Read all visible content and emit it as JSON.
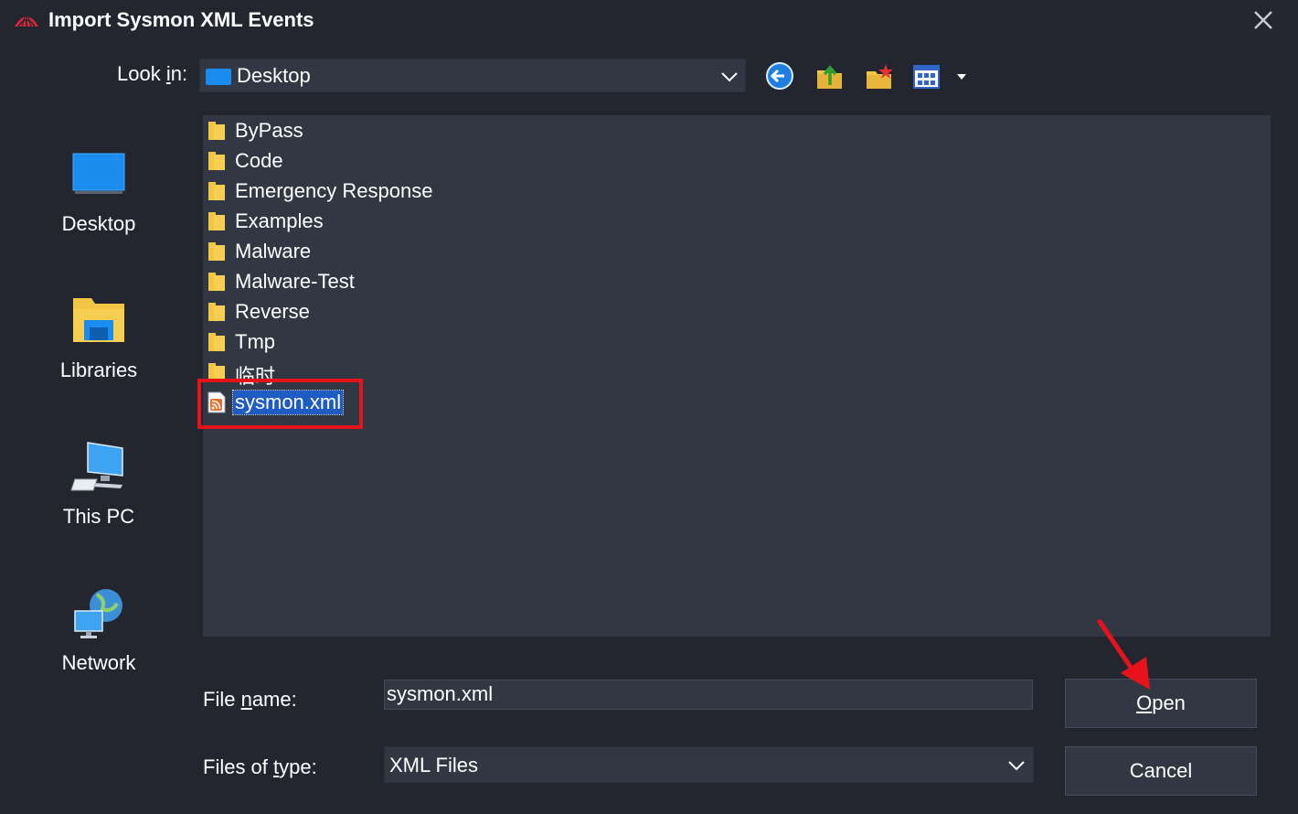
{
  "window": {
    "title": "Import Sysmon XML Events"
  },
  "lookin": {
    "label_pre": "Look ",
    "label_u": "i",
    "label_post": "n:",
    "value": "Desktop"
  },
  "toolbar": {
    "icons": [
      "back-icon",
      "up-folder-icon",
      "new-folder-icon",
      "view-menu-icon"
    ]
  },
  "places": [
    {
      "label": "Desktop",
      "icon": "desktop-icon"
    },
    {
      "label": "Libraries",
      "icon": "libraries-icon"
    },
    {
      "label": "This PC",
      "icon": "this-pc-icon"
    },
    {
      "label": "Network",
      "icon": "network-icon"
    }
  ],
  "files": [
    {
      "name": "ByPass",
      "type": "folder"
    },
    {
      "name": "Code",
      "type": "folder"
    },
    {
      "name": "Emergency Response",
      "type": "folder"
    },
    {
      "name": "Examples",
      "type": "folder"
    },
    {
      "name": "Malware",
      "type": "folder"
    },
    {
      "name": "Malware-Test",
      "type": "folder"
    },
    {
      "name": "Reverse",
      "type": "folder"
    },
    {
      "name": "Tmp",
      "type": "folder"
    },
    {
      "name": "临时",
      "type": "folder"
    },
    {
      "name": "sysmon.xml",
      "type": "xml",
      "selected": true
    }
  ],
  "filename": {
    "label_pre": "File ",
    "label_u": "n",
    "label_post": "ame:",
    "value": "sysmon.xml"
  },
  "filetype": {
    "label_pre": "Files of ",
    "label_u": "t",
    "label_post": "ype:",
    "value": "XML Files"
  },
  "buttons": {
    "open_u": "O",
    "open_rest": "pen",
    "cancel": "Cancel"
  },
  "colors": {
    "background": "#23262f",
    "panel": "#323744",
    "selection": "#1e5cc4",
    "highlight": "#e8131a"
  }
}
